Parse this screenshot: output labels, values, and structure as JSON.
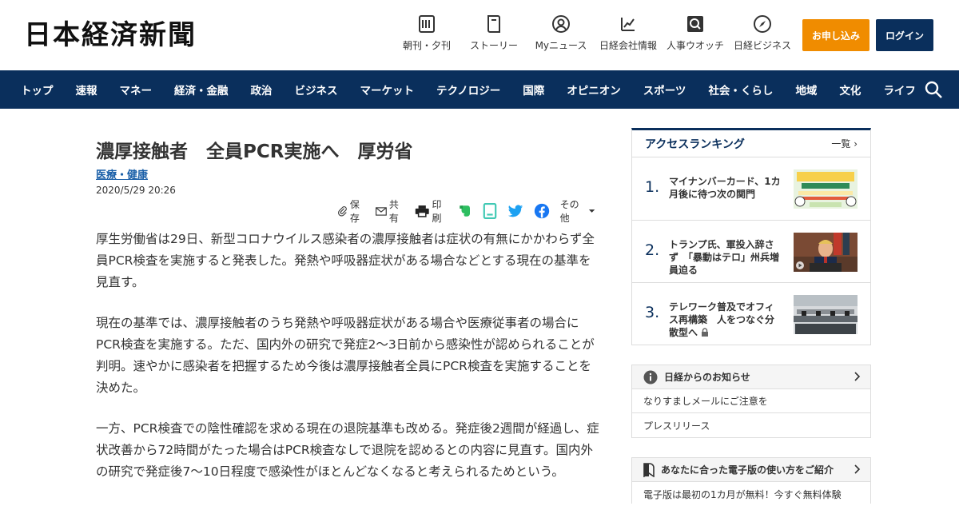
{
  "header": {
    "logo": "日本経済新聞",
    "nav": [
      {
        "label": "朝刊・夕刊",
        "icon": "newspaper-icon"
      },
      {
        "label": "ストーリー",
        "icon": "book-icon"
      },
      {
        "label": "Myニュース",
        "icon": "user-icon"
      },
      {
        "label": "日経会社情報",
        "icon": "chart-icon"
      },
      {
        "label": "人事ウオッチ",
        "icon": "magnifier-icon"
      },
      {
        "label": "日経ビジネス",
        "icon": "compass-icon"
      }
    ],
    "apply_label": "お申し込み",
    "login_label": "ログイン",
    "apply_color": "#f08c00",
    "brand_color": "#0a2f5c"
  },
  "navbar": {
    "items": [
      "トップ",
      "速報",
      "マネー",
      "経済・金融",
      "政治",
      "ビジネス",
      "マーケット",
      "テクノロジー",
      "国際",
      "オピニオン",
      "スポーツ",
      "社会・くらし",
      "地域",
      "文化",
      "ライフ"
    ]
  },
  "article": {
    "title": "濃厚接触者　全員PCR実施へ　厚労省",
    "category": "医療・健康",
    "date": "2020/5/29 20:26",
    "share": {
      "save": "保存",
      "share": "共有",
      "print": "印刷",
      "more": "その他"
    },
    "paragraphs": [
      "厚生労働省は29日、新型コロナウイルス感染者の濃厚接触者は症状の有無にかかわらず全員PCR検査を実施すると発表した。発熱や呼吸器症状がある場合などとする現在の基準を見直す。",
      "現在の基準では、濃厚接触者のうち発熱や呼吸器症状がある場合や医療従事者の場合にPCR検査を実施する。ただ、国内外の研究で発症2～3日前から感染性が認められることが判明。速やかに感染者を把握するため今後は濃厚接触者全員にPCR検査を実施することを決めた。",
      "一方、PCR検査での陰性確認を求める現在の退院基準も改める。発症後2週間が経過し、症状改善から72時間がたった場合はPCR検査なしで退院を認めるとの内容に見直す。国内外の研究で発症後7～10日程度で感染性がほとんどなくなると考えられるためという。"
    ]
  },
  "ranking": {
    "title": "アクセスランキング",
    "more": "一覧",
    "items": [
      {
        "num": "1.",
        "text": "マイナンバーカード、1カ月後に待つ次の関門"
      },
      {
        "num": "2.",
        "text": "トランプ氏、軍投入辞さず　「暴動はテロ」州兵増員迫る"
      },
      {
        "num": "3.",
        "text": "テレワーク普及でオフィス再構築　人をつなぐ分散型へ"
      }
    ]
  },
  "notice": {
    "title": "日経からのお知らせ",
    "rows": [
      "なりすましメールにご注意を",
      "プレスリリース"
    ]
  },
  "guide": {
    "title": "あなたに合った電子版の使い方をご紹介",
    "rows": [
      "電子版は最初の1カ月が無料！今すぐ無料体験"
    ]
  }
}
